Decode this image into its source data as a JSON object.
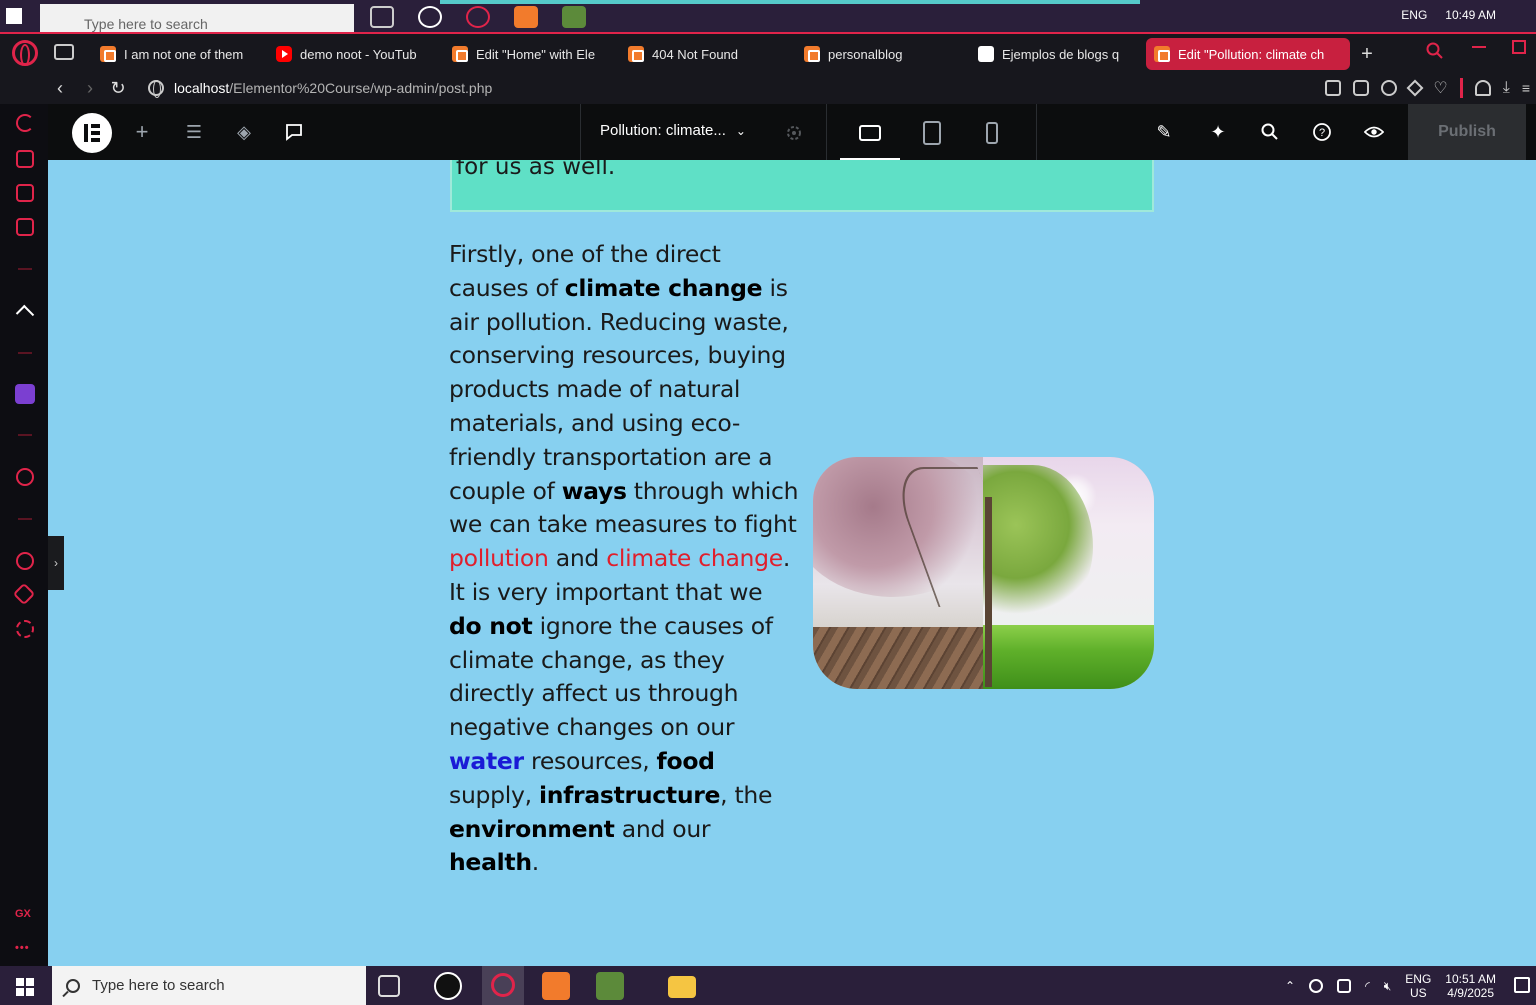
{
  "top_taskbar": {
    "search_placeholder": "Type here to search",
    "lang": "ENG",
    "time": "10:49 AM"
  },
  "browser": {
    "tabs": [
      {
        "label": "I am not one of them",
        "favicon": "xampp-icon"
      },
      {
        "label": "demo noot - YouTub",
        "favicon": "youtube-icon"
      },
      {
        "label": "Edit \"Home\" with Ele",
        "favicon": "xampp-icon"
      },
      {
        "label": "404 Not Found",
        "favicon": "xampp-icon"
      },
      {
        "label": "personalblog",
        "favicon": "xampp-icon"
      },
      {
        "label": "Ejemplos de blogs q",
        "favicon": "wix-icon"
      },
      {
        "label": "Edit \"Pollution: climate ch",
        "favicon": "xampp-icon",
        "active": true
      }
    ],
    "new_tab": "+",
    "url_host": "localhost",
    "url_path": "/Elementor%20Course/wp-admin/post.php",
    "accent_color": "#e0244a"
  },
  "elementor": {
    "document_title": "Pollution: climate...",
    "publish_label": "Publish",
    "toolbar_icons": [
      "elementor-logo-icon",
      "add-element-icon",
      "site-settings-icon",
      "structure-icon",
      "notes-icon"
    ],
    "right_icons": [
      "integrations-icon",
      "finder-icon",
      "search-icon",
      "help-icon",
      "preview-icon"
    ],
    "devices": [
      "desktop",
      "tablet",
      "mobile"
    ],
    "active_device": "desktop"
  },
  "canvas": {
    "background_color": "#87d0f0",
    "green_box_text": "for us as well.",
    "article": {
      "p1": "Firstly, one of the direct causes of ",
      "b1": "climate change",
      "p2": " is air pollution. Reducing waste, conserving resources, buying products made of natural materials, and using eco-friendly transportation are a couple of ",
      "b2": "ways",
      "p3": " through which we can take measures to fight ",
      "r1": "pollution",
      "p4": " and ",
      "r2": "climate change",
      "p5": ". It is very important that we ",
      "b3": "do not",
      "p6": " ignore the causes of climate change, as they directly affect us through negative changes on our ",
      "bl1": "water",
      "p7": " resources, ",
      "b4": "food",
      "p8": " supply, ",
      "b5": "infrastructure",
      "p9": ", the ",
      "b6": "environment",
      "p10": " and our ",
      "b7": "health",
      "p11": "."
    },
    "image_alt_icon": "climate-tree-image"
  },
  "taskbar": {
    "search_placeholder": "Type here to search",
    "lang": "ENG",
    "region": "US",
    "time": "10:51 AM",
    "date": "4/9/2025"
  }
}
